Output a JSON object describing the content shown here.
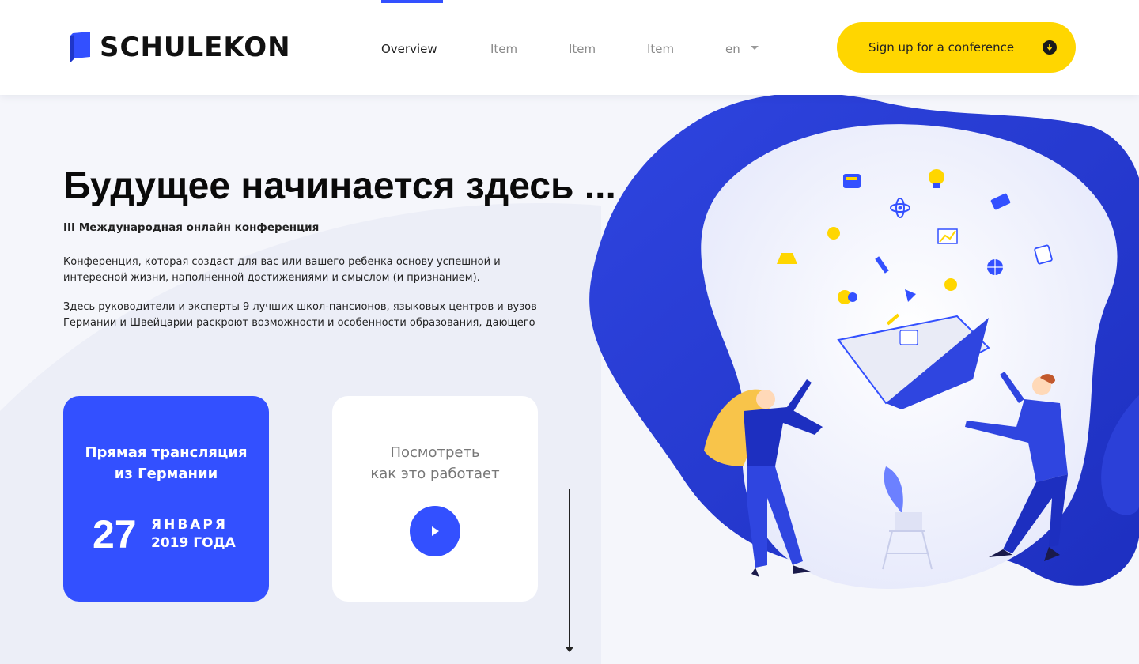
{
  "header": {
    "logo_text": "SCHULEKON",
    "nav": [
      {
        "label": "Overview"
      },
      {
        "label": "Item"
      },
      {
        "label": "Item"
      },
      {
        "label": "Item"
      }
    ],
    "language": "en",
    "cta_label": "Sign up for a conference"
  },
  "hero": {
    "title": "Будущее начинается здесь ...",
    "subtitle": "III Международная онлайн конференция",
    "paragraph1": "Конференция, которая создаст для вас или вашего ребенка основу успешной и интересной жизни, наполненной достижениями и смыслом (и признанием).",
    "paragraph2": "Здесь руководители и эксперты 9 лучших школ-пансионов, языковых центров и вузов Германии и Швейцарии раскроют возможности и особенности образования, дающего"
  },
  "live_card": {
    "title_line1": "Прямая трансляция",
    "title_line2": "из Германии",
    "day": "27",
    "month": "ЯНВАРЯ",
    "year": "2019 ГОДА"
  },
  "video_card": {
    "title_line1": "Посмотреть",
    "title_line2": "как это работает"
  },
  "colors": {
    "accent": "#3350ff",
    "cta": "#ffd600",
    "background": "#f5f6fb"
  }
}
